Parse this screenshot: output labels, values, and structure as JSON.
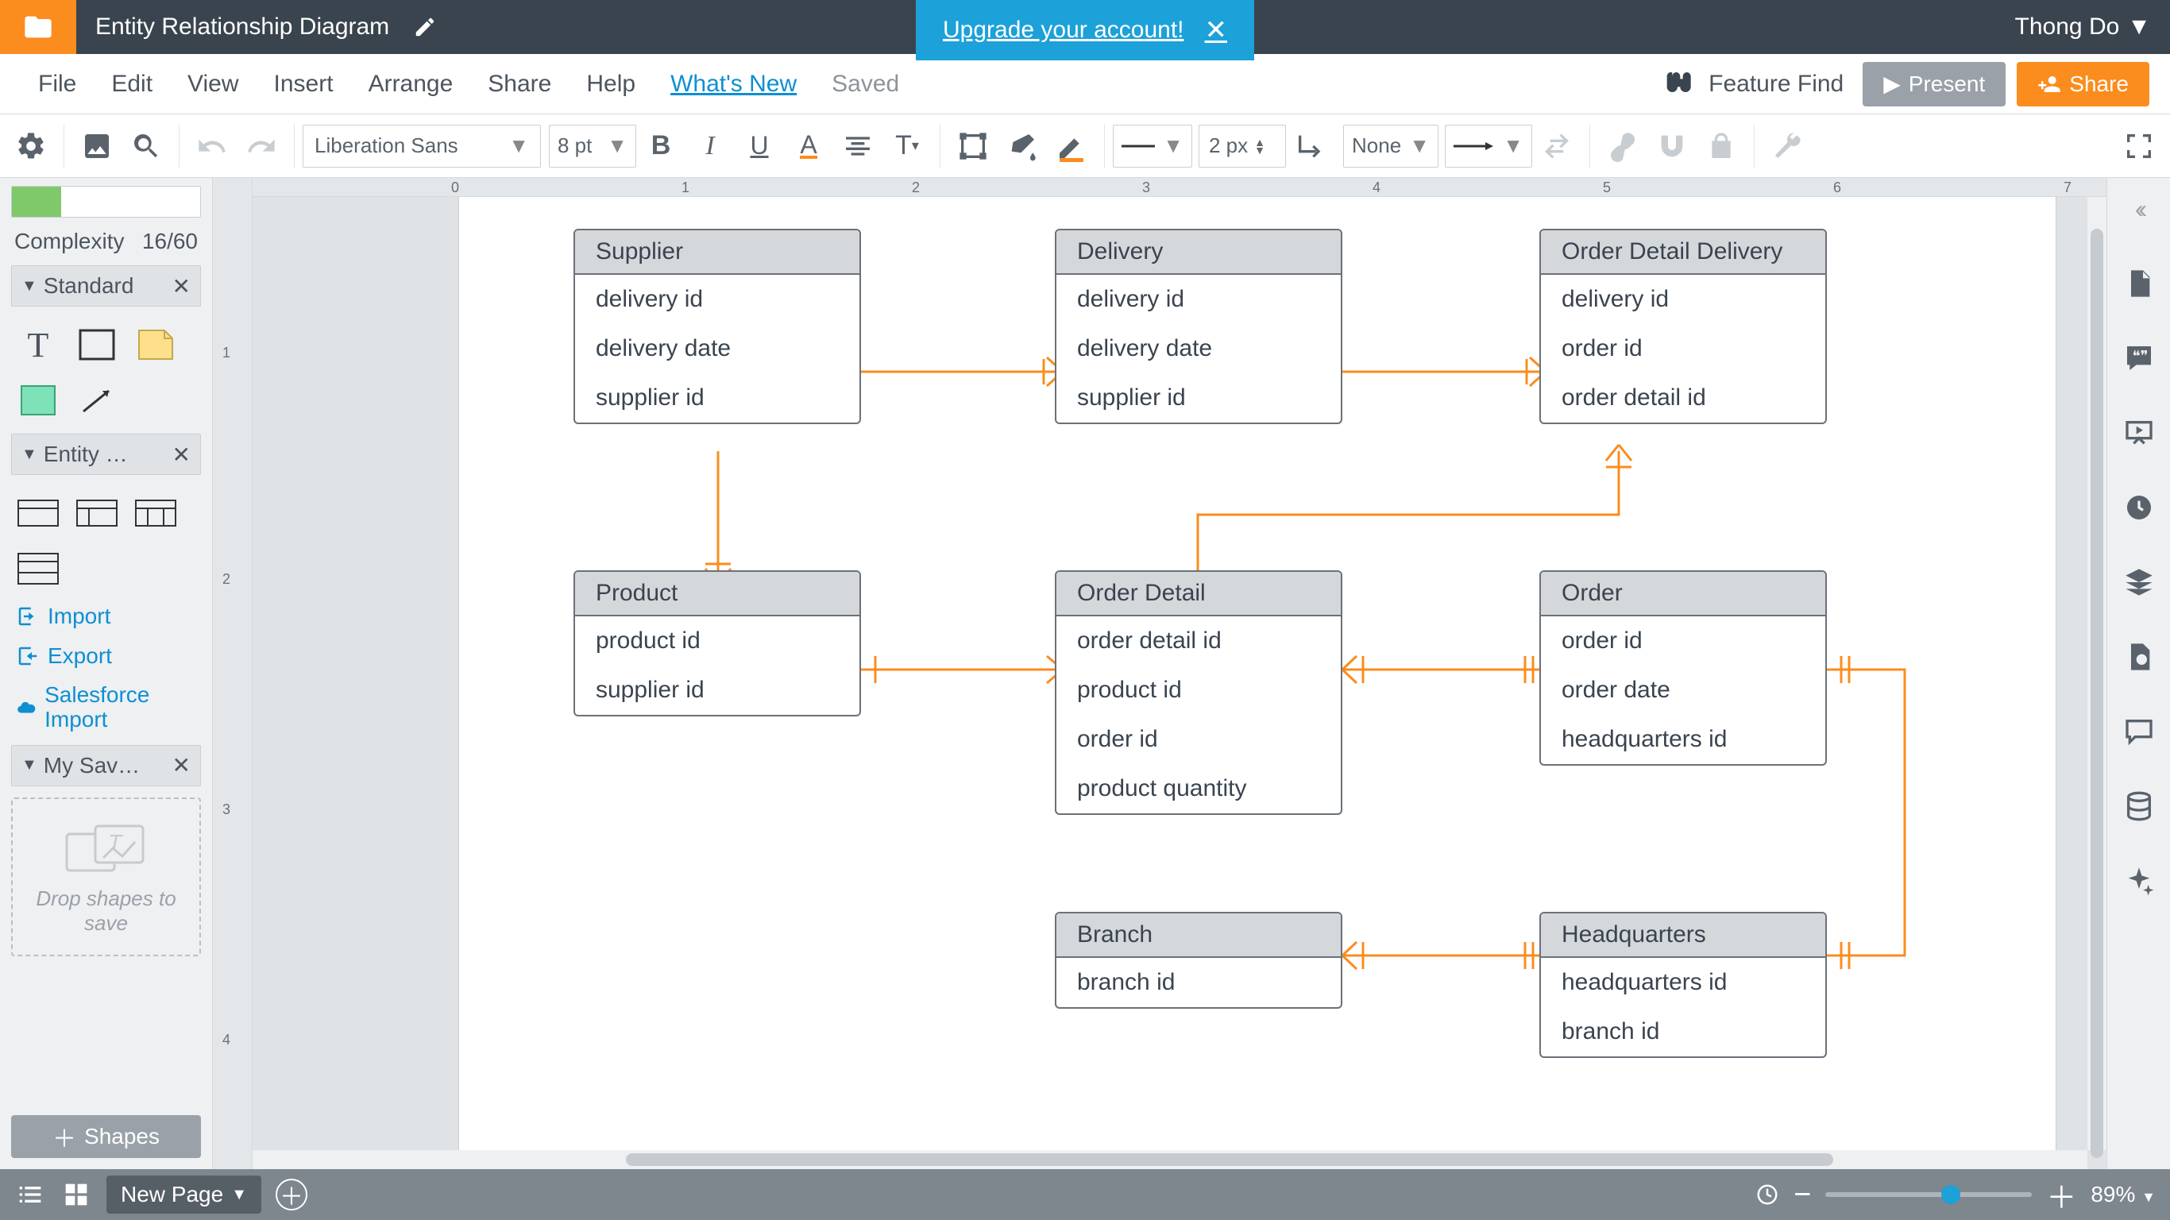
{
  "titlebar": {
    "doc_title": "Entity Relationship Diagram",
    "upgrade": "Upgrade your account!",
    "user": "Thong Do"
  },
  "menu": {
    "file": "File",
    "edit": "Edit",
    "view": "View",
    "insert": "Insert",
    "arrange": "Arrange",
    "share": "Share",
    "help": "Help",
    "whats_new": "What's New",
    "saved": "Saved",
    "feature_find": "Feature Find",
    "present": "Present",
    "share_btn": "Share"
  },
  "toolbar": {
    "font": "Liberation Sans",
    "font_size": "8 pt",
    "line_width": "2 px",
    "fill_mode": "None"
  },
  "left": {
    "complexity_label": "Complexity",
    "complexity_value": "16/60",
    "lib_standard": "Standard",
    "lib_entity": "Entity …",
    "lib_mysaved": "My Sav…",
    "import": "Import",
    "export": "Export",
    "sf_import": "Salesforce Import",
    "drop_hint": "Drop shapes to save",
    "shapes_btn": "Shapes"
  },
  "canvas": {
    "entities": {
      "supplier": {
        "title": "Supplier",
        "rows": [
          "delivery id",
          "delivery date",
          "supplier id"
        ]
      },
      "delivery": {
        "title": "Delivery",
        "rows": [
          "delivery id",
          "delivery date",
          "supplier id"
        ]
      },
      "odd": {
        "title": "Order Detail Delivery",
        "rows": [
          "delivery id",
          "order id",
          "order detail id"
        ]
      },
      "product": {
        "title": "Product",
        "rows": [
          "product id",
          "supplier id"
        ]
      },
      "orderdetail": {
        "title": "Order Detail",
        "rows": [
          "order detail id",
          "product id",
          "order id",
          "product quantity"
        ]
      },
      "order": {
        "title": "Order",
        "rows": [
          "order id",
          "order date",
          "headquarters id"
        ]
      },
      "branch": {
        "title": "Branch",
        "rows": [
          "branch id"
        ]
      },
      "hq": {
        "title": "Headquarters",
        "rows": [
          "headquarters id",
          "branch id"
        ]
      }
    }
  },
  "bottom": {
    "page_tab": "New Page",
    "zoom": "89%"
  },
  "ruler_h": [
    "0",
    "1",
    "2",
    "3",
    "4",
    "5",
    "6",
    "7"
  ],
  "ruler_v": [
    "1",
    "2",
    "3",
    "4"
  ]
}
